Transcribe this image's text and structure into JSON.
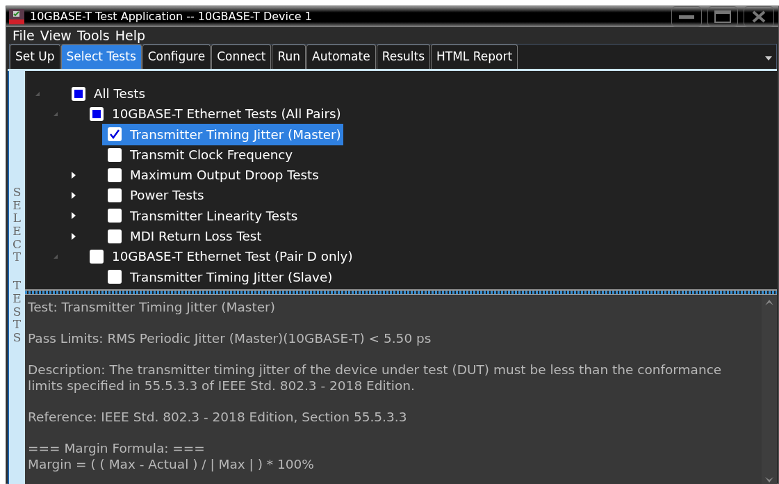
{
  "window": {
    "title": "10GBASE-T Test Application -- 10GBASE-T Device 1"
  },
  "menu": [
    "File",
    "View",
    "Tools",
    "Help"
  ],
  "tabs": [
    {
      "label": "Set Up",
      "selected": false
    },
    {
      "label": "Select Tests",
      "selected": true
    },
    {
      "label": "Configure",
      "selected": false
    },
    {
      "label": "Connect",
      "selected": false
    },
    {
      "label": "Run",
      "selected": false
    },
    {
      "label": "Automate",
      "selected": false
    },
    {
      "label": "Results",
      "selected": false
    },
    {
      "label": "HTML Report",
      "selected": false
    }
  ],
  "side_label": [
    "SELECT",
    "TESTS"
  ],
  "tree": [
    {
      "label": "All Tests",
      "checked": false,
      "partial": true,
      "expanded": true,
      "selected": false,
      "children": [
        {
          "label": "10GBASE-T Ethernet Tests (All Pairs)",
          "checked": false,
          "partial": true,
          "expanded": true,
          "selected": false,
          "children": [
            {
              "label": "Transmitter Timing Jitter (Master)",
              "checked": true,
              "partial": false,
              "selected": true
            },
            {
              "label": "Transmit Clock Frequency",
              "checked": false,
              "partial": false,
              "selected": false
            },
            {
              "label": "Maximum Output Droop Tests",
              "checked": false,
              "partial": false,
              "expanded": false,
              "selected": false
            },
            {
              "label": "Power Tests",
              "checked": false,
              "partial": false,
              "expanded": false,
              "selected": false
            },
            {
              "label": "Transmitter Linearity Tests",
              "checked": false,
              "partial": false,
              "expanded": false,
              "selected": false
            },
            {
              "label": "MDI Return Loss Test",
              "checked": false,
              "partial": false,
              "expanded": false,
              "selected": false
            }
          ]
        },
        {
          "label": "10GBASE-T Ethernet Test (Pair D only)",
          "checked": false,
          "partial": false,
          "expanded": true,
          "selected": false,
          "children": [
            {
              "label": "Transmitter Timing Jitter (Slave)",
              "checked": false,
              "partial": false,
              "selected": false
            }
          ]
        }
      ]
    }
  ],
  "details": [
    {
      "lines": [
        "Test: Transmitter Timing Jitter (Master)"
      ]
    },
    {
      "lines": [
        "Pass Limits: RMS Periodic Jitter (Master)(10GBASE-T) < 5.50 ps"
      ]
    },
    {
      "lines": [
        "Description: The transmitter timing jitter of the device under test (DUT) must be less than the conformance",
        "limits specified in 55.5.3.3 of IEEE Std. 802.3 - 2018 Edition."
      ]
    },
    {
      "lines": [
        "Reference: IEEE Std. 802.3 - 2018 Edition, Section 55.5.3.3"
      ]
    },
    {
      "lines": [
        "=== Margin Formula: ===",
        "Margin = ( ( Max - Actual ) / | Max | ) * 100%"
      ]
    }
  ]
}
